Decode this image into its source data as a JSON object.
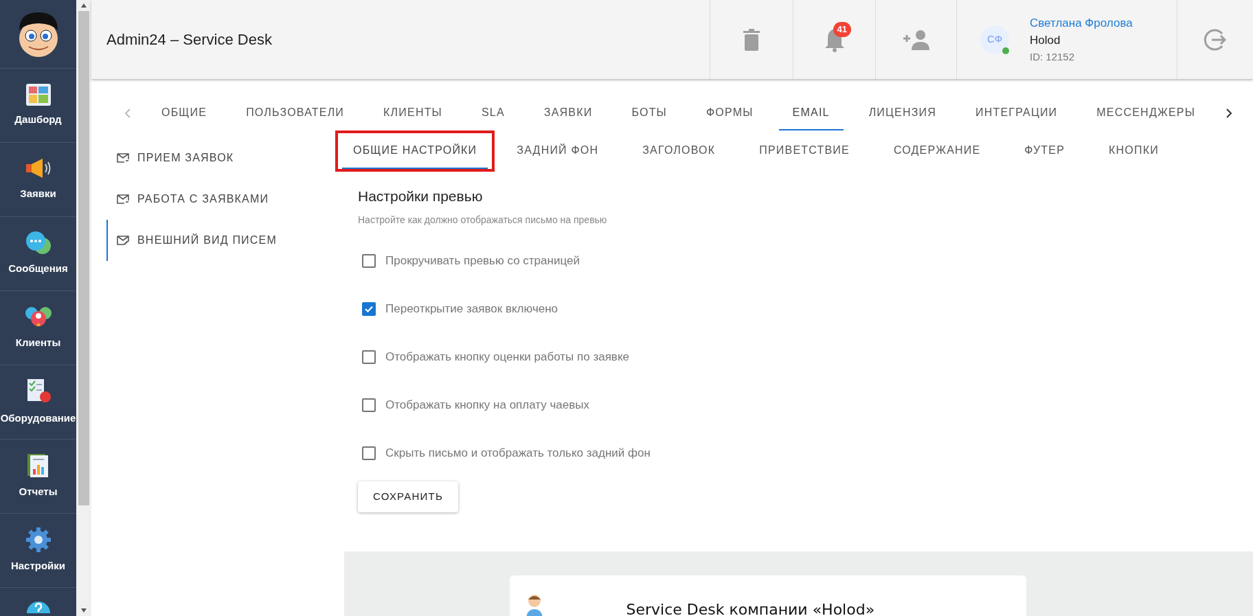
{
  "app": {
    "title": "Admin24 – Service Desk"
  },
  "sidebar": {
    "items": [
      {
        "kind": "dashboard",
        "label": "Дашборд"
      },
      {
        "kind": "requests",
        "label": "Заявки"
      },
      {
        "kind": "messages",
        "label": "Сообщения"
      },
      {
        "kind": "clients",
        "label": "Клиенты"
      },
      {
        "kind": "equipment",
        "label": "Оборудование"
      },
      {
        "kind": "reports",
        "label": "Отчеты"
      },
      {
        "kind": "settings",
        "label": "Настройки"
      },
      {
        "kind": "help"
      }
    ]
  },
  "header": {
    "notifications": {
      "count": "41"
    },
    "user": {
      "initials": "СФ",
      "name": "Светлана Фролова",
      "company": "Holod",
      "id": "ID: 12152",
      "online": true
    }
  },
  "tabs": [
    {
      "label": "ОБЩИЕ",
      "selected": false
    },
    {
      "label": "ПОЛЬЗОВАТЕЛИ",
      "selected": false
    },
    {
      "label": "КЛИЕНТЫ",
      "selected": false
    },
    {
      "label": "SLA",
      "selected": false
    },
    {
      "label": "ЗАЯВКИ",
      "selected": false
    },
    {
      "label": "БОТЫ",
      "selected": false
    },
    {
      "label": "ФОРМЫ",
      "selected": false
    },
    {
      "label": "EMAIL",
      "selected": true
    },
    {
      "label": "ЛИЦЕНЗИЯ",
      "selected": false
    },
    {
      "label": "ИНТЕГРАЦИИ",
      "selected": false
    },
    {
      "label": "МЕССЕНДЖЕРЫ",
      "selected": false
    }
  ],
  "side_menu": [
    {
      "label": "ПРИЕМ ЗАЯВОК",
      "selected": false
    },
    {
      "label": "РАБОТА С ЗАЯВКАМИ",
      "selected": false
    },
    {
      "label": "ВНЕШНИЙ ВИД ПИСЕМ",
      "selected": true
    }
  ],
  "sub_tabs": [
    {
      "label": "ОБЩИЕ НАСТРОЙКИ",
      "selected": true,
      "highlighted": true
    },
    {
      "label": "ЗАДНИЙ ФОН",
      "selected": false,
      "highlighted": false
    },
    {
      "label": "ЗАГОЛОВОК",
      "selected": false,
      "highlighted": false
    },
    {
      "label": "ПРИВЕТСТВИЕ",
      "selected": false,
      "highlighted": false
    },
    {
      "label": "СОДЕРЖАНИЕ",
      "selected": false,
      "highlighted": false
    },
    {
      "label": "ФУТЕР",
      "selected": false,
      "highlighted": false
    },
    {
      "label": "КНОПКИ",
      "selected": false,
      "highlighted": false
    }
  ],
  "settings": {
    "title": "Настройки превью",
    "subtitle": "Настройте как должно отображаться письмо на превью",
    "options": [
      {
        "label": "Прокручивать превью со страницей",
        "checked": false
      },
      {
        "label": "Переоткрытие заявок включено",
        "checked": true
      },
      {
        "label": "Отображать кнопку оценки работы по заявке",
        "checked": false
      },
      {
        "label": "Отображать кнопку на оплату чаевых",
        "checked": false
      },
      {
        "label": "Скрыть письмо и отображать только задний фон",
        "checked": false
      }
    ],
    "save_button": "СОХРАНИТЬ"
  },
  "preview": {
    "title": "Service Desk компании «Holod»"
  }
}
